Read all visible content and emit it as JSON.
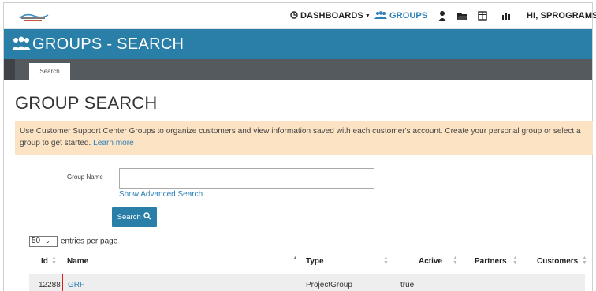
{
  "nav": {
    "dashboards": "DASHBOARDS",
    "groups": "GROUPS",
    "user": "HI, SPROGRAMS",
    "icons": [
      "clock-icon",
      "groups-icon",
      "person-icon",
      "folder-icon",
      "table-icon",
      "bar-chart-icon"
    ],
    "accent": "#2c7fb8"
  },
  "header": {
    "title": "GROUPS - SEARCH",
    "color": "#2a7fa8"
  },
  "tabs": [
    {
      "label": "Search"
    }
  ],
  "page": {
    "title": "GROUP SEARCH"
  },
  "info": {
    "text": "Use Customer Support Center Groups to organize customers and view information saved with each customer's account. Create your personal group or select a group to get started.",
    "link": "Learn more",
    "background": "#fbe3c4"
  },
  "form": {
    "group_name_label": "Group Name",
    "group_name_value": "",
    "advanced_link": "Show Advanced Search",
    "search_button": "Search"
  },
  "table": {
    "page_size": "50",
    "entries_label": "entries per page",
    "columns": [
      "Id",
      "Name",
      "Type",
      "Active",
      "Partners",
      "Customers"
    ],
    "rows": [
      {
        "id": "12288",
        "name": "GRF",
        "type": "ProjectGroup",
        "active": "true",
        "partners": "",
        "customers": ""
      }
    ]
  }
}
